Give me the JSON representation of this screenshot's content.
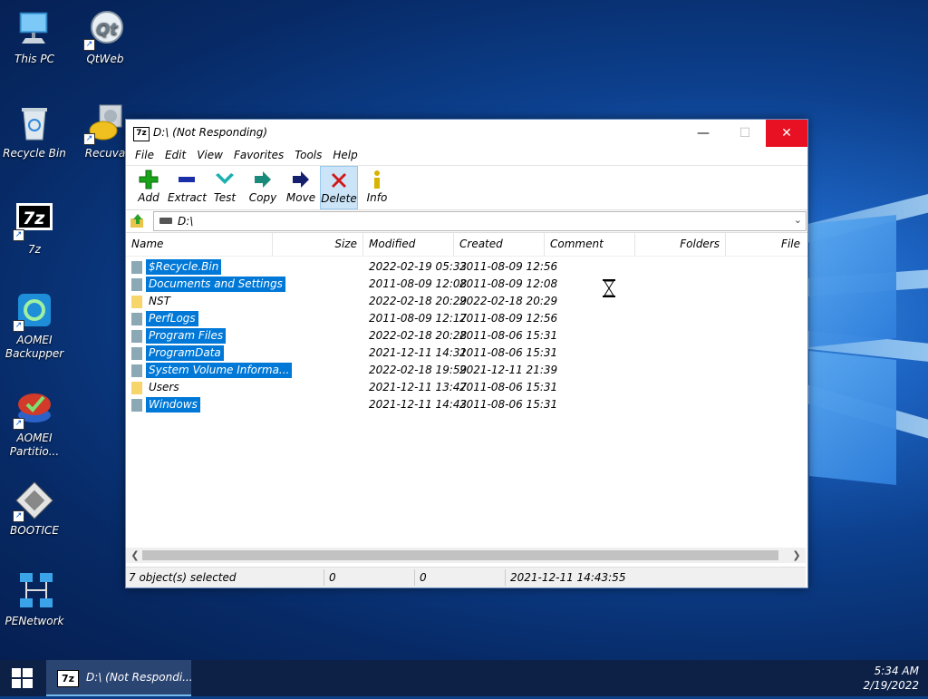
{
  "desktop": {
    "icons": [
      {
        "label": "This PC"
      },
      {
        "label": "QtWeb"
      },
      {
        "label": "Recycle Bin"
      },
      {
        "label": "Recuva"
      },
      {
        "label": "7z"
      },
      {
        "label": "AOMEI Backupper"
      },
      {
        "label": "AOMEI Partitio..."
      },
      {
        "label": "BOOTICE"
      },
      {
        "label": "PENetwork"
      }
    ]
  },
  "window": {
    "title": "D:\\ (Not Responding)",
    "app_icon_text": "7z",
    "controls": {
      "minimize": "—",
      "maximize": "☐",
      "close": "✕"
    },
    "menu": [
      "File",
      "Edit",
      "View",
      "Favorites",
      "Tools",
      "Help"
    ],
    "toolbar": [
      {
        "label": "Add",
        "icon": "plus-icon",
        "color": "#1aa31a"
      },
      {
        "label": "Extract",
        "icon": "minus-icon",
        "color": "#1a2ea8"
      },
      {
        "label": "Test",
        "icon": "check-icon",
        "color": "#1ab0b0"
      },
      {
        "label": "Copy",
        "icon": "copy-arrow-icon",
        "color": "#1a8a7a"
      },
      {
        "label": "Move",
        "icon": "move-arrow-icon",
        "color": "#14206e"
      },
      {
        "label": "Delete",
        "icon": "delete-x-icon",
        "color": "#d01818"
      },
      {
        "label": "Info",
        "icon": "info-icon",
        "color": "#d8b400"
      }
    ],
    "active_tool": "Delete",
    "address": "D:\\",
    "columns": [
      "Name",
      "Size",
      "Modified",
      "Created",
      "Comment",
      "Folders",
      "File"
    ],
    "files": [
      {
        "name": "$Recycle.Bin",
        "modified": "2022-02-19 05:33",
        "created": "2011-08-09 12:56",
        "selected": true,
        "hidden": true
      },
      {
        "name": "Documents and Settings",
        "modified": "2011-08-09 12:08",
        "created": "2011-08-09 12:08",
        "selected": true,
        "hidden": true
      },
      {
        "name": "NST",
        "modified": "2022-02-18 20:29",
        "created": "2022-02-18 20:29",
        "selected": false,
        "hidden": false
      },
      {
        "name": "PerfLogs",
        "modified": "2011-08-09 12:17",
        "created": "2011-08-09 12:56",
        "selected": true,
        "hidden": true
      },
      {
        "name": "Program Files",
        "modified": "2022-02-18 20:28",
        "created": "2011-08-06 15:31",
        "selected": true,
        "hidden": true
      },
      {
        "name": "ProgramData",
        "modified": "2021-12-11 14:31",
        "created": "2011-08-06 15:31",
        "selected": true,
        "hidden": true
      },
      {
        "name": "System Volume Informa...",
        "modified": "2022-02-18 19:59",
        "created": "2021-12-11 21:39",
        "selected": true,
        "hidden": true
      },
      {
        "name": "Users",
        "modified": "2021-12-11 13:47",
        "created": "2011-08-06 15:31",
        "selected": false,
        "hidden": false
      },
      {
        "name": "Windows",
        "modified": "2021-12-11 14:43",
        "created": "2011-08-06 15:31",
        "selected": true,
        "hidden": true
      }
    ],
    "status": {
      "selected": "7 object(s) selected",
      "size": "0",
      "packed": "0",
      "date": "2021-12-11 14:43:55"
    }
  },
  "taskbar": {
    "task_label": "D:\\ (Not Respondi...",
    "task_icon_text": "7z",
    "time": "5:34 AM",
    "date": "2/19/2022"
  },
  "colors": {
    "selection": "#0078d7",
    "close_button": "#e81123",
    "taskbar": "#0d2147",
    "folder": "#f7d56a",
    "hidden_folder": "#8aa9b5"
  }
}
